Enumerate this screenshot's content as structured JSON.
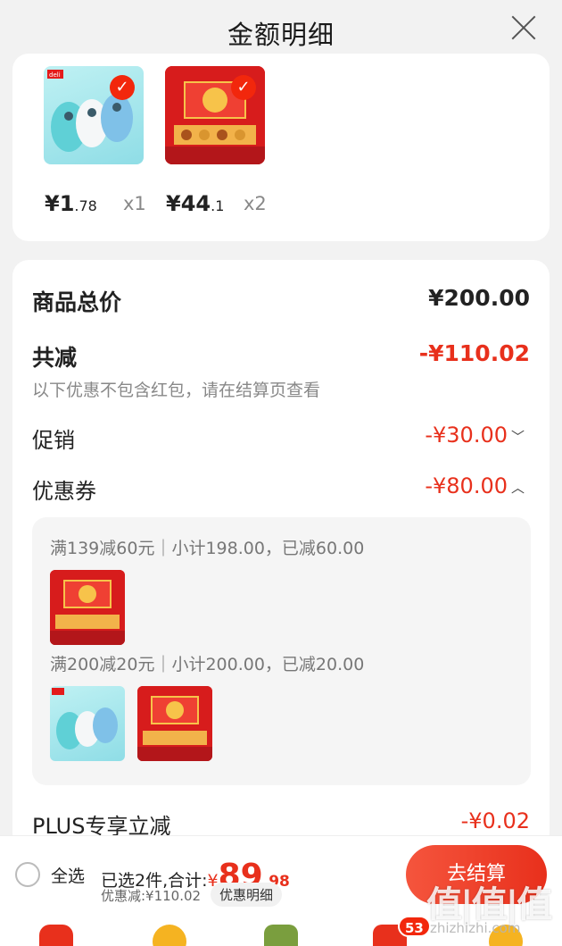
{
  "header": {
    "title": "金额明细"
  },
  "products": [
    {
      "brand": "deli",
      "price_int": "1",
      "price_dec": ".78",
      "qty": "x1"
    },
    {
      "price_int": "44",
      "price_dec": ".1",
      "qty": "x2"
    }
  ],
  "currency": "¥",
  "summary": {
    "total_label": "商品总价",
    "total_value": "¥200.00",
    "reduce_label": "共减",
    "reduce_value": "-¥110.02",
    "reduce_note": "以下优惠不包含红包，请在结算页查看",
    "promo_label": "促销",
    "promo_value": "-¥30.00",
    "coupon_label": "优惠券",
    "coupon_value": "-¥80.00",
    "plus_label": "PLUS专享立减",
    "plus_value": "-¥0.02"
  },
  "coupons": [
    {
      "title": "满139减60元｜小计198.00，已减60.00"
    },
    {
      "title": "满200减20元｜小计200.00，已减20.00"
    }
  ],
  "bottom": {
    "select_all": "全选",
    "selected_text": "已选2件,合计:",
    "currency": "¥",
    "amount_int": "89",
    "amount_dec": ".98",
    "discount_text": "优惠减:¥110.02",
    "detail_button": "优惠明细",
    "checkout_button": "去结算"
  },
  "tabbar": {
    "cart_badge": "53"
  },
  "watermark": {
    "main": "值|值|值",
    "sub": "zhizhizhi.com"
  },
  "colors": {
    "accent": "#e8301c",
    "background": "#f2f2f2"
  }
}
